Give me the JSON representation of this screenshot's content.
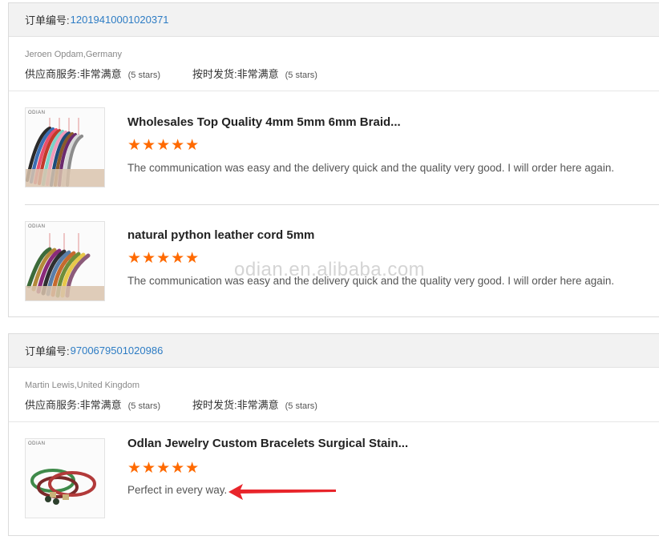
{
  "orders": [
    {
      "order_label": "订单编号:",
      "order_number": "12019410001020371",
      "buyer": "Jeroen Opdam,Germany",
      "ratings": [
        {
          "label": "供应商服务:",
          "value": "非常满意",
          "stars": "(5 stars)"
        },
        {
          "label": "按时发货:",
          "value": "非常满意",
          "stars": "(5 stars)"
        }
      ],
      "products": [
        {
          "title": "Wholesales Top Quality 4mm 5mm 6mm Braid...",
          "rating": "★★★★★",
          "comment": "The communication was easy and the delivery quick and the quality very good. I will order here again.",
          "thumb_logo": "ODIAN"
        },
        {
          "title": "natural python leather cord 5mm",
          "rating": "★★★★★",
          "comment": "The communication was easy and the delivery quick and the quality very good. I will order here again.",
          "thumb_logo": "ODIAN"
        }
      ]
    },
    {
      "order_label": "订单编号:",
      "order_number": "9700679501020986",
      "buyer": "Martin Lewis,United Kingdom",
      "ratings": [
        {
          "label": "供应商服务:",
          "value": "非常满意",
          "stars": "(5 stars)"
        },
        {
          "label": "按时发货:",
          "value": "非常满意",
          "stars": "(5 stars)"
        }
      ],
      "products": [
        {
          "title": "Odlan Jewelry Custom Bracelets Surgical Stain...",
          "rating": "★★★★★",
          "comment": "Perfect in every way.",
          "thumb_logo": "ODIAN"
        }
      ]
    }
  ],
  "watermark": "odian.en.alibaba.com",
  "colors": {
    "order_number": "#2d7cc4",
    "star": "#ff6a00",
    "arrow": "#e8252b"
  }
}
